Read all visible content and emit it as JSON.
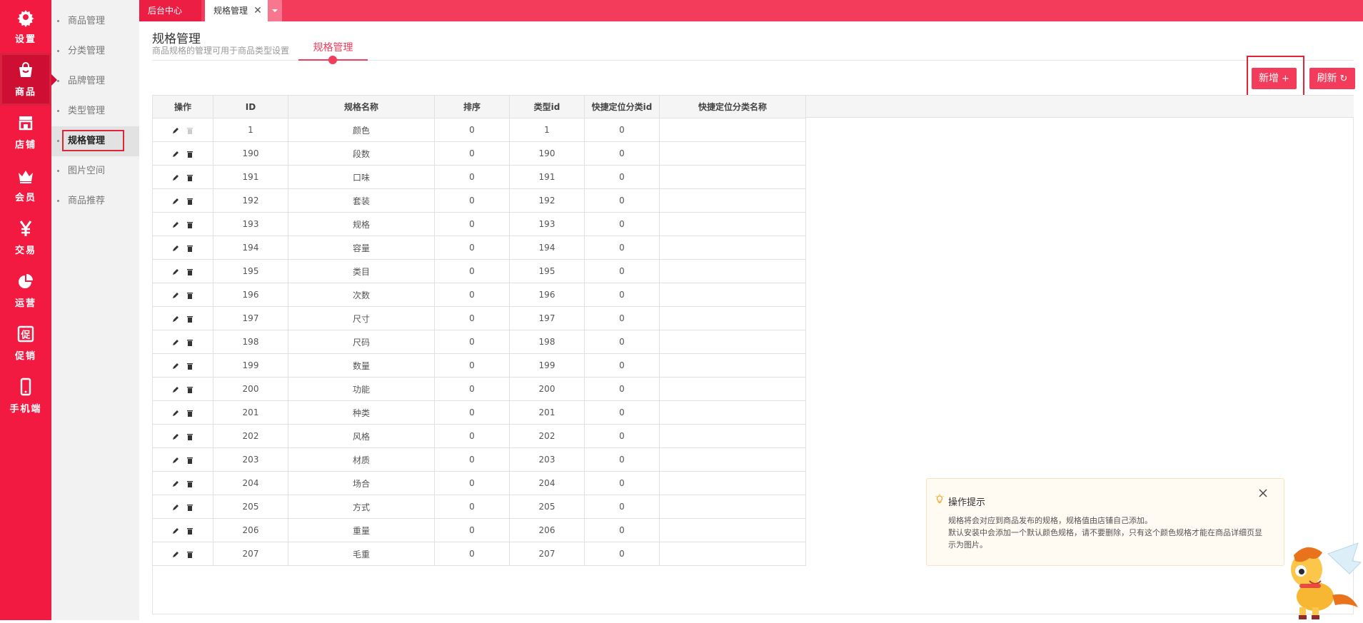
{
  "primary_nav": [
    {
      "label": "设置",
      "icon": "gear-icon"
    },
    {
      "label": "商品",
      "icon": "shopping-bag-icon",
      "active": true
    },
    {
      "label": "店铺",
      "icon": "store-icon"
    },
    {
      "label": "会员",
      "icon": "crown-icon"
    },
    {
      "label": "交易",
      "icon": "yen-icon"
    },
    {
      "label": "运营",
      "icon": "pie-chart-icon"
    },
    {
      "label": "促销",
      "icon": "promotion-icon"
    },
    {
      "label": "手机端",
      "icon": "mobile-icon"
    }
  ],
  "secondary_nav": [
    {
      "label": "商品管理"
    },
    {
      "label": "分类管理"
    },
    {
      "label": "品牌管理"
    },
    {
      "label": "类型管理"
    },
    {
      "label": "规格管理",
      "active": true
    },
    {
      "label": "图片空间"
    },
    {
      "label": "商品推荐"
    }
  ],
  "tabs": {
    "home": "后台中心",
    "current": "规格管理",
    "close_symbol": "✕"
  },
  "page": {
    "title": "规格管理",
    "subtitle": "商品规格的管理可用于商品类型设置",
    "tab_label": "规格管理"
  },
  "buttons": {
    "add": "新增",
    "add_symbol": "+",
    "refresh": "刷新",
    "refresh_symbol": "↻"
  },
  "table": {
    "columns": [
      "操作",
      "ID",
      "规格名称",
      "排序",
      "类型id",
      "快捷定位分类id",
      "快捷定位分类名称"
    ],
    "rows": [
      {
        "id": "1",
        "name": "颜色",
        "sort": "0",
        "type_id": "1",
        "cat_id": "0",
        "cat_name": "",
        "deletable": false
      },
      {
        "id": "190",
        "name": "段数",
        "sort": "0",
        "type_id": "190",
        "cat_id": "0",
        "cat_name": "",
        "deletable": true
      },
      {
        "id": "191",
        "name": "口味",
        "sort": "0",
        "type_id": "191",
        "cat_id": "0",
        "cat_name": "",
        "deletable": true
      },
      {
        "id": "192",
        "name": "套装",
        "sort": "0",
        "type_id": "192",
        "cat_id": "0",
        "cat_name": "",
        "deletable": true
      },
      {
        "id": "193",
        "name": "规格",
        "sort": "0",
        "type_id": "193",
        "cat_id": "0",
        "cat_name": "",
        "deletable": true
      },
      {
        "id": "194",
        "name": "容量",
        "sort": "0",
        "type_id": "194",
        "cat_id": "0",
        "cat_name": "",
        "deletable": true
      },
      {
        "id": "195",
        "name": "类目",
        "sort": "0",
        "type_id": "195",
        "cat_id": "0",
        "cat_name": "",
        "deletable": true
      },
      {
        "id": "196",
        "name": "次数",
        "sort": "0",
        "type_id": "196",
        "cat_id": "0",
        "cat_name": "",
        "deletable": true
      },
      {
        "id": "197",
        "name": "尺寸",
        "sort": "0",
        "type_id": "197",
        "cat_id": "0",
        "cat_name": "",
        "deletable": true
      },
      {
        "id": "198",
        "name": "尺码",
        "sort": "0",
        "type_id": "198",
        "cat_id": "0",
        "cat_name": "",
        "deletable": true
      },
      {
        "id": "199",
        "name": "数量",
        "sort": "0",
        "type_id": "199",
        "cat_id": "0",
        "cat_name": "",
        "deletable": true
      },
      {
        "id": "200",
        "name": "功能",
        "sort": "0",
        "type_id": "200",
        "cat_id": "0",
        "cat_name": "",
        "deletable": true
      },
      {
        "id": "201",
        "name": "种类",
        "sort": "0",
        "type_id": "201",
        "cat_id": "0",
        "cat_name": "",
        "deletable": true
      },
      {
        "id": "202",
        "name": "风格",
        "sort": "0",
        "type_id": "202",
        "cat_id": "0",
        "cat_name": "",
        "deletable": true
      },
      {
        "id": "203",
        "name": "材质",
        "sort": "0",
        "type_id": "203",
        "cat_id": "0",
        "cat_name": "",
        "deletable": true
      },
      {
        "id": "204",
        "name": "场合",
        "sort": "0",
        "type_id": "204",
        "cat_id": "0",
        "cat_name": "",
        "deletable": true
      },
      {
        "id": "205",
        "name": "方式",
        "sort": "0",
        "type_id": "205",
        "cat_id": "0",
        "cat_name": "",
        "deletable": true
      },
      {
        "id": "206",
        "name": "重量",
        "sort": "0",
        "type_id": "206",
        "cat_id": "0",
        "cat_name": "",
        "deletable": true
      },
      {
        "id": "207",
        "name": "毛重",
        "sort": "0",
        "type_id": "207",
        "cat_id": "0",
        "cat_name": "",
        "deletable": true
      }
    ]
  },
  "tips": {
    "title": "操作提示",
    "lines": [
      "规格将会对应到商品发布的规格，规格值由店铺自己添加。",
      "默认安装中会添加一个默认颜色规格，请不要删除，只有这个颜色规格才能在商品详细页显示为图片。"
    ]
  },
  "colors": {
    "brand": "#f31a42",
    "accent": "#f33c5b",
    "tab_bar": "#f33c5b",
    "highlight_border": "#e0243a"
  }
}
